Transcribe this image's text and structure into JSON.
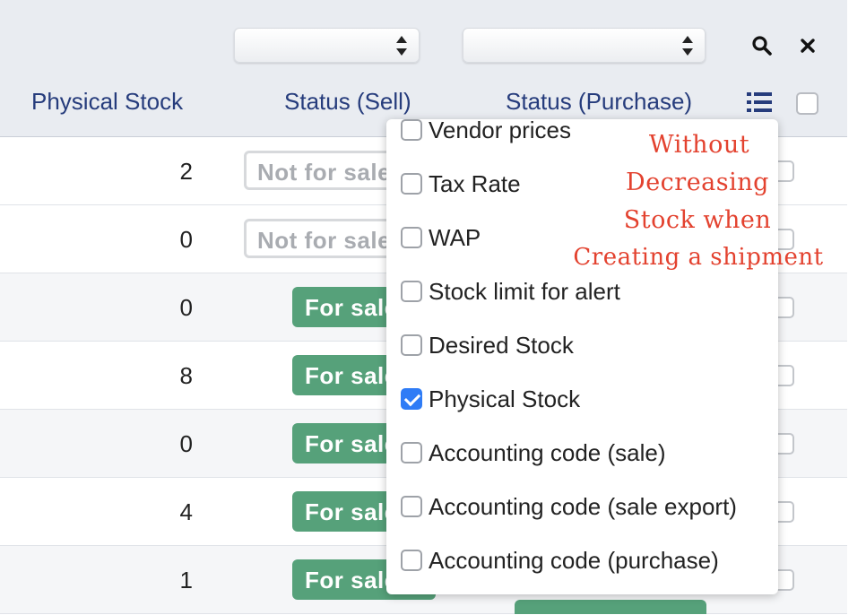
{
  "header": {
    "filters": [
      {
        "name": "status-sell-filter",
        "value": ""
      },
      {
        "name": "status-purchase-filter",
        "value": ""
      }
    ],
    "columns": {
      "physical_stock": "Physical Stock",
      "status_sell": "Status (Sell)",
      "status_purchase": "Status (Purchase)"
    },
    "icons": [
      "search-icon",
      "close-icon",
      "list-icon"
    ]
  },
  "rows": [
    {
      "physical_stock": "2",
      "status_sell": "Not for sale",
      "sell_style": "outline"
    },
    {
      "physical_stock": "0",
      "status_sell": "Not for sale",
      "sell_style": "outline"
    },
    {
      "physical_stock": "0",
      "status_sell": "For sale",
      "sell_style": "green"
    },
    {
      "physical_stock": "8",
      "status_sell": "For sale",
      "sell_style": "green"
    },
    {
      "physical_stock": "0",
      "status_sell": "For sale",
      "sell_style": "green"
    },
    {
      "physical_stock": "4",
      "status_sell": "For sale",
      "sell_style": "green"
    },
    {
      "physical_stock": "1",
      "status_sell": "For sale",
      "sell_style": "green"
    }
  ],
  "column_menu": {
    "options": [
      {
        "label": "Vendor prices",
        "checked": false
      },
      {
        "label": "Tax Rate",
        "checked": false
      },
      {
        "label": "WAP",
        "checked": false
      },
      {
        "label": "Stock limit for alert",
        "checked": false
      },
      {
        "label": "Desired Stock",
        "checked": false
      },
      {
        "label": "Physical Stock",
        "checked": true
      },
      {
        "label": "Accounting code (sale)",
        "checked": false
      },
      {
        "label": "Accounting code (sale export)",
        "checked": false
      },
      {
        "label": "Accounting code (purchase)",
        "checked": false
      }
    ]
  },
  "annotation": {
    "lines": [
      "Without",
      "Decreasing",
      "Stock when",
      "Creating a shipment"
    ],
    "color": "#e3422f"
  },
  "colors": {
    "header_text": "#263c7c",
    "sale_green": "#56a17a",
    "checkbox_blue": "#2f7cf6"
  }
}
